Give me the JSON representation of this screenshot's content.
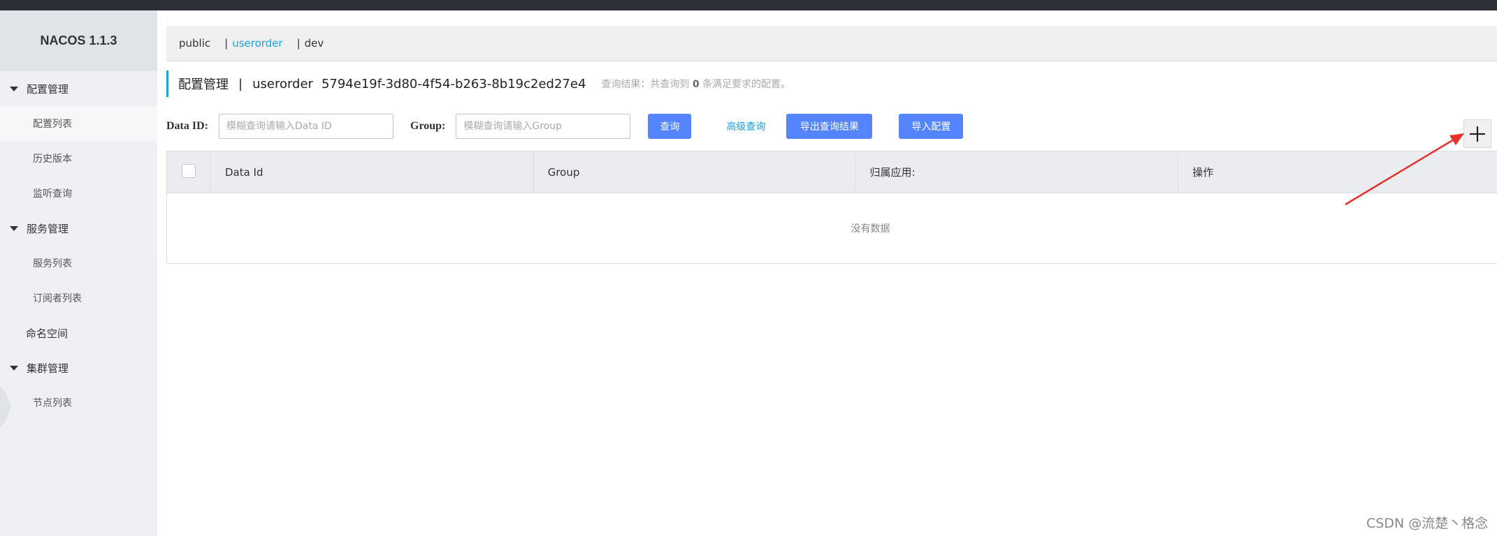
{
  "sidebar": {
    "brand": "NACOS 1.1.3",
    "groups": [
      {
        "label": "配置管理",
        "items": [
          "配置列表",
          "历史版本",
          "监听查询"
        ]
      },
      {
        "label": "服务管理",
        "items": [
          "服务列表",
          "订阅者列表"
        ]
      },
      {
        "label": "命名空间"
      },
      {
        "label": "集群管理",
        "items": [
          "节点列表"
        ]
      }
    ]
  },
  "namespaces": [
    {
      "label": "public",
      "active": false
    },
    {
      "label": "userorder",
      "active": true
    },
    {
      "label": "dev",
      "active": false
    }
  ],
  "header": {
    "title": "配置管理",
    "separator": "|",
    "namespace": "userorder",
    "namespace_id": "5794e19f-3d80-4f54-b263-8b19c2ed27e4",
    "result_prefix": "查询结果：共查询到",
    "result_count": "0",
    "result_suffix": "条满足要求的配置。"
  },
  "search": {
    "dataid_label": "Data ID:",
    "dataid_placeholder": "模糊查询请输入Data ID",
    "group_label": "Group:",
    "group_placeholder": "模糊查询请输入Group",
    "query_button": "查询",
    "advanced_query": "高级查询",
    "export_button": "导出查询结果",
    "import_button": "导入配置"
  },
  "add_button_symbol": "+",
  "table": {
    "columns": [
      "Data Id",
      "Group",
      "归属应用:",
      "操作"
    ],
    "empty_text": "没有数据"
  },
  "watermark": "CSDN @流楚丶格念",
  "colors": {
    "primary": "#5584ff",
    "link": "#1aa3e0",
    "sidebar_bg": "#eef0f3",
    "annotation_arrow": "#e8302a"
  }
}
